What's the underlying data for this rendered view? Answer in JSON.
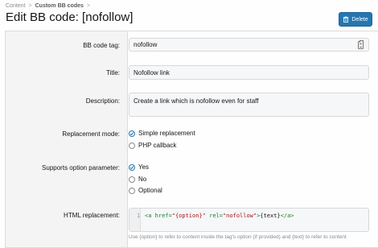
{
  "breadcrumb": {
    "items": [
      "Content",
      "Custom BB codes"
    ],
    "separator": ">"
  },
  "page_title": "Edit BB code: [nofollow]",
  "delete_button": {
    "label": "Delete",
    "color": "#2577b1"
  },
  "form": {
    "tag": {
      "label": "BB code tag:",
      "value": "nofollow"
    },
    "title": {
      "label": "Title:",
      "value": "Nofollow link"
    },
    "description": {
      "label": "Description:",
      "value": "Create a link which is nofollow even for staff"
    },
    "replacement_mode": {
      "label": "Replacement mode:",
      "options": [
        "Simple replacement",
        "PHP callback"
      ],
      "selected": "Simple replacement"
    },
    "option_param": {
      "label": "Supports option parameter:",
      "options": [
        "Yes",
        "No",
        "Optional"
      ],
      "selected": "Yes"
    },
    "html_replacement": {
      "label": "HTML replacement:",
      "line_number": "1",
      "tokens": {
        "open": "<a ",
        "attr1": "href=",
        "val1": "\"{option}\"",
        "attr2": " rel=",
        "val2": "\"nofollow\"",
        "close": ">",
        "text": "{text}",
        "end": "</a>"
      },
      "hint": "Use {option} to refer to content inside the tag's option (if provided) and {text} to refer to content"
    }
  }
}
